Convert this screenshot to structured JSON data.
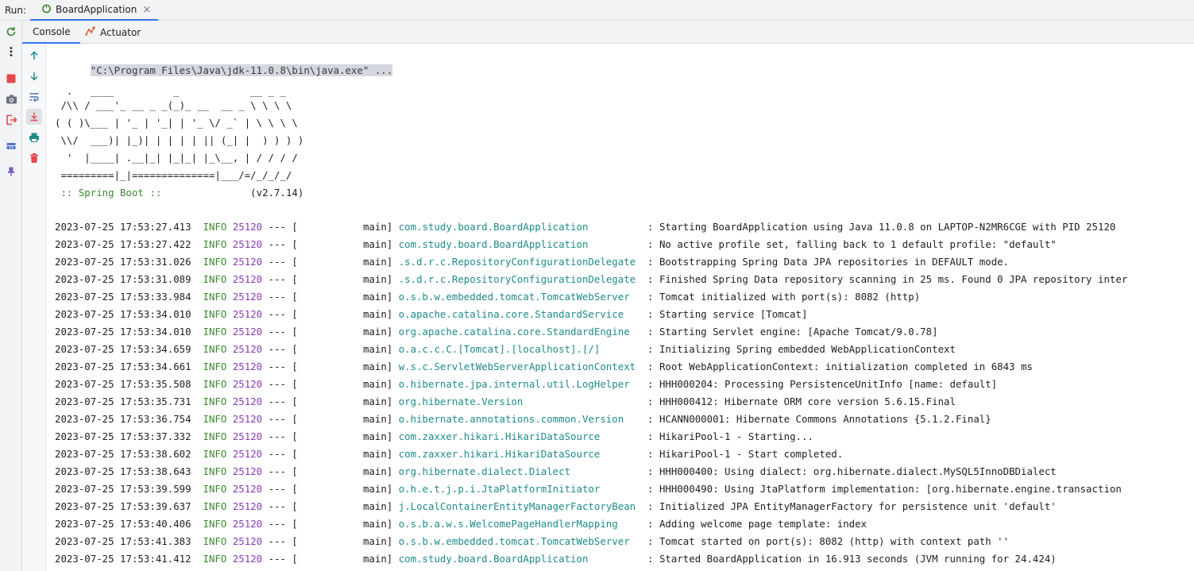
{
  "runbar": {
    "label": "Run:",
    "tab_title": "BoardApplication",
    "close": "×"
  },
  "subtabs": {
    "console": "Console",
    "actuator": "Actuator"
  },
  "console": {
    "command": "\"C:\\Program Files\\Java\\jdk-11.0.8\\bin\\java.exe\" ...",
    "banner": [
      "  .   ____          _            __ _ _",
      " /\\\\ / ___'_ __ _ _(_)_ __  __ _ \\ \\ \\ \\",
      "( ( )\\___ | '_ | '_| | '_ \\/ _` | \\ \\ \\ \\",
      " \\\\/  ___)| |_)| | | | | || (_| |  ) ) ) )",
      "  '  |____| .__|_| |_|_| |_\\__, | / / / /",
      " =========|_|==============|___/=/_/_/_/"
    ],
    "boot_label": " :: Spring Boot :: ",
    "boot_version": "              (v2.7.14)",
    "logs": [
      {
        "ts": "2023-07-25 17:53:27.413",
        "level": "INFO",
        "pid": "25120",
        "thread": "main",
        "logger": "com.study.board.BoardApplication",
        "msg": "Starting BoardApplication using Java 11.0.8 on LAPTOP-N2MR6CGE with PID 25120"
      },
      {
        "ts": "2023-07-25 17:53:27.422",
        "level": "INFO",
        "pid": "25120",
        "thread": "main",
        "logger": "com.study.board.BoardApplication",
        "msg": "No active profile set, falling back to 1 default profile: \"default\""
      },
      {
        "ts": "2023-07-25 17:53:31.026",
        "level": "INFO",
        "pid": "25120",
        "thread": "main",
        "logger": ".s.d.r.c.RepositoryConfigurationDelegate",
        "msg": "Bootstrapping Spring Data JPA repositories in DEFAULT mode."
      },
      {
        "ts": "2023-07-25 17:53:31.089",
        "level": "INFO",
        "pid": "25120",
        "thread": "main",
        "logger": ".s.d.r.c.RepositoryConfigurationDelegate",
        "msg": "Finished Spring Data repository scanning in 25 ms. Found 0 JPA repository inter"
      },
      {
        "ts": "2023-07-25 17:53:33.984",
        "level": "INFO",
        "pid": "25120",
        "thread": "main",
        "logger": "o.s.b.w.embedded.tomcat.TomcatWebServer",
        "msg": "Tomcat initialized with port(s): 8082 (http)"
      },
      {
        "ts": "2023-07-25 17:53:34.010",
        "level": "INFO",
        "pid": "25120",
        "thread": "main",
        "logger": "o.apache.catalina.core.StandardService",
        "msg": "Starting service [Tomcat]"
      },
      {
        "ts": "2023-07-25 17:53:34.010",
        "level": "INFO",
        "pid": "25120",
        "thread": "main",
        "logger": "org.apache.catalina.core.StandardEngine",
        "msg": "Starting Servlet engine: [Apache Tomcat/9.0.78]"
      },
      {
        "ts": "2023-07-25 17:53:34.659",
        "level": "INFO",
        "pid": "25120",
        "thread": "main",
        "logger": "o.a.c.c.C.[Tomcat].[localhost].[/]",
        "msg": "Initializing Spring embedded WebApplicationContext"
      },
      {
        "ts": "2023-07-25 17:53:34.661",
        "level": "INFO",
        "pid": "25120",
        "thread": "main",
        "logger": "w.s.c.ServletWebServerApplicationContext",
        "msg": "Root WebApplicationContext: initialization completed in 6843 ms"
      },
      {
        "ts": "2023-07-25 17:53:35.508",
        "level": "INFO",
        "pid": "25120",
        "thread": "main",
        "logger": "o.hibernate.jpa.internal.util.LogHelper",
        "msg": "HHH000204: Processing PersistenceUnitInfo [name: default]"
      },
      {
        "ts": "2023-07-25 17:53:35.731",
        "level": "INFO",
        "pid": "25120",
        "thread": "main",
        "logger": "org.hibernate.Version",
        "msg": "HHH000412: Hibernate ORM core version 5.6.15.Final"
      },
      {
        "ts": "2023-07-25 17:53:36.754",
        "level": "INFO",
        "pid": "25120",
        "thread": "main",
        "logger": "o.hibernate.annotations.common.Version",
        "msg": "HCANN000001: Hibernate Commons Annotations {5.1.2.Final}"
      },
      {
        "ts": "2023-07-25 17:53:37.332",
        "level": "INFO",
        "pid": "25120",
        "thread": "main",
        "logger": "com.zaxxer.hikari.HikariDataSource",
        "msg": "HikariPool-1 - Starting..."
      },
      {
        "ts": "2023-07-25 17:53:38.602",
        "level": "INFO",
        "pid": "25120",
        "thread": "main",
        "logger": "com.zaxxer.hikari.HikariDataSource",
        "msg": "HikariPool-1 - Start completed."
      },
      {
        "ts": "2023-07-25 17:53:38.643",
        "level": "INFO",
        "pid": "25120",
        "thread": "main",
        "logger": "org.hibernate.dialect.Dialect",
        "msg": "HHH000400: Using dialect: org.hibernate.dialect.MySQL5InnoDBDialect"
      },
      {
        "ts": "2023-07-25 17:53:39.599",
        "level": "INFO",
        "pid": "25120",
        "thread": "main",
        "logger": "o.h.e.t.j.p.i.JtaPlatformInitiator",
        "msg": "HHH000490: Using JtaPlatform implementation: [org.hibernate.engine.transaction"
      },
      {
        "ts": "2023-07-25 17:53:39.637",
        "level": "INFO",
        "pid": "25120",
        "thread": "main",
        "logger": "j.LocalContainerEntityManagerFactoryBean",
        "msg": "Initialized JPA EntityManagerFactory for persistence unit 'default'"
      },
      {
        "ts": "2023-07-25 17:53:40.406",
        "level": "INFO",
        "pid": "25120",
        "thread": "main",
        "logger": "o.s.b.a.w.s.WelcomePageHandlerMapping",
        "msg": "Adding welcome page template: index"
      },
      {
        "ts": "2023-07-25 17:53:41.383",
        "level": "INFO",
        "pid": "25120",
        "thread": "main",
        "logger": "o.s.b.w.embedded.tomcat.TomcatWebServer",
        "msg": "Tomcat started on port(s): 8082 (http) with context path ''"
      },
      {
        "ts": "2023-07-25 17:53:41.412",
        "level": "INFO",
        "pid": "25120",
        "thread": "main",
        "logger": "com.study.board.BoardApplication",
        "msg": "Started BoardApplication in 16.913 seconds (JVM running for 24.424)"
      }
    ]
  },
  "colors": {
    "accent": "#3574f0",
    "level_info": "#3b8a2f",
    "pid": "#8a3bb5",
    "logger": "#1f8a8a",
    "stop_red": "#e5484d"
  },
  "icons": {
    "rerun": "rerun-icon",
    "more": "more-vertical-icon",
    "stop": "stop-icon",
    "snapshot": "camera-icon",
    "exit": "exit-icon",
    "layout": "layout-icon",
    "pin": "pin-icon",
    "up": "arrow-up-icon",
    "down": "arrow-down-icon",
    "wrap": "soft-wrap-icon",
    "scroll_end": "scroll-to-end-icon",
    "print": "print-icon",
    "trash": "trash-icon"
  }
}
